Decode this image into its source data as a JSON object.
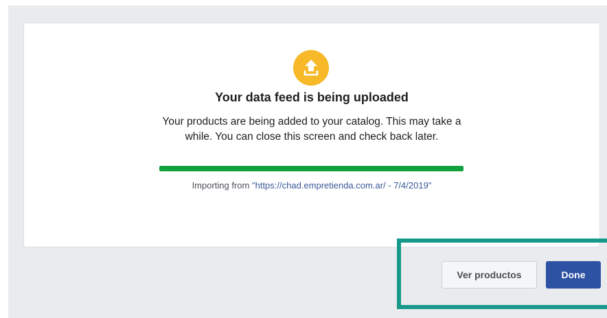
{
  "dialog": {
    "icon": "upload-icon",
    "title": "Your data feed is being uploaded",
    "description": "Your products are being added to your catalog. This may take a while. You can close this screen and check back later.",
    "progress_percent": 100,
    "import_prefix": "Importing from ",
    "import_source": "\"https://chad.empretienda.com.ar/ - 7/4/2019\""
  },
  "footer": {
    "secondary_label": "Ver productos",
    "primary_label": "Done"
  },
  "colors": {
    "icon_bg": "#f7b928",
    "progress": "#12a23d",
    "primary_button": "#2d52a4",
    "link": "#385898",
    "highlight": "#16998a"
  }
}
